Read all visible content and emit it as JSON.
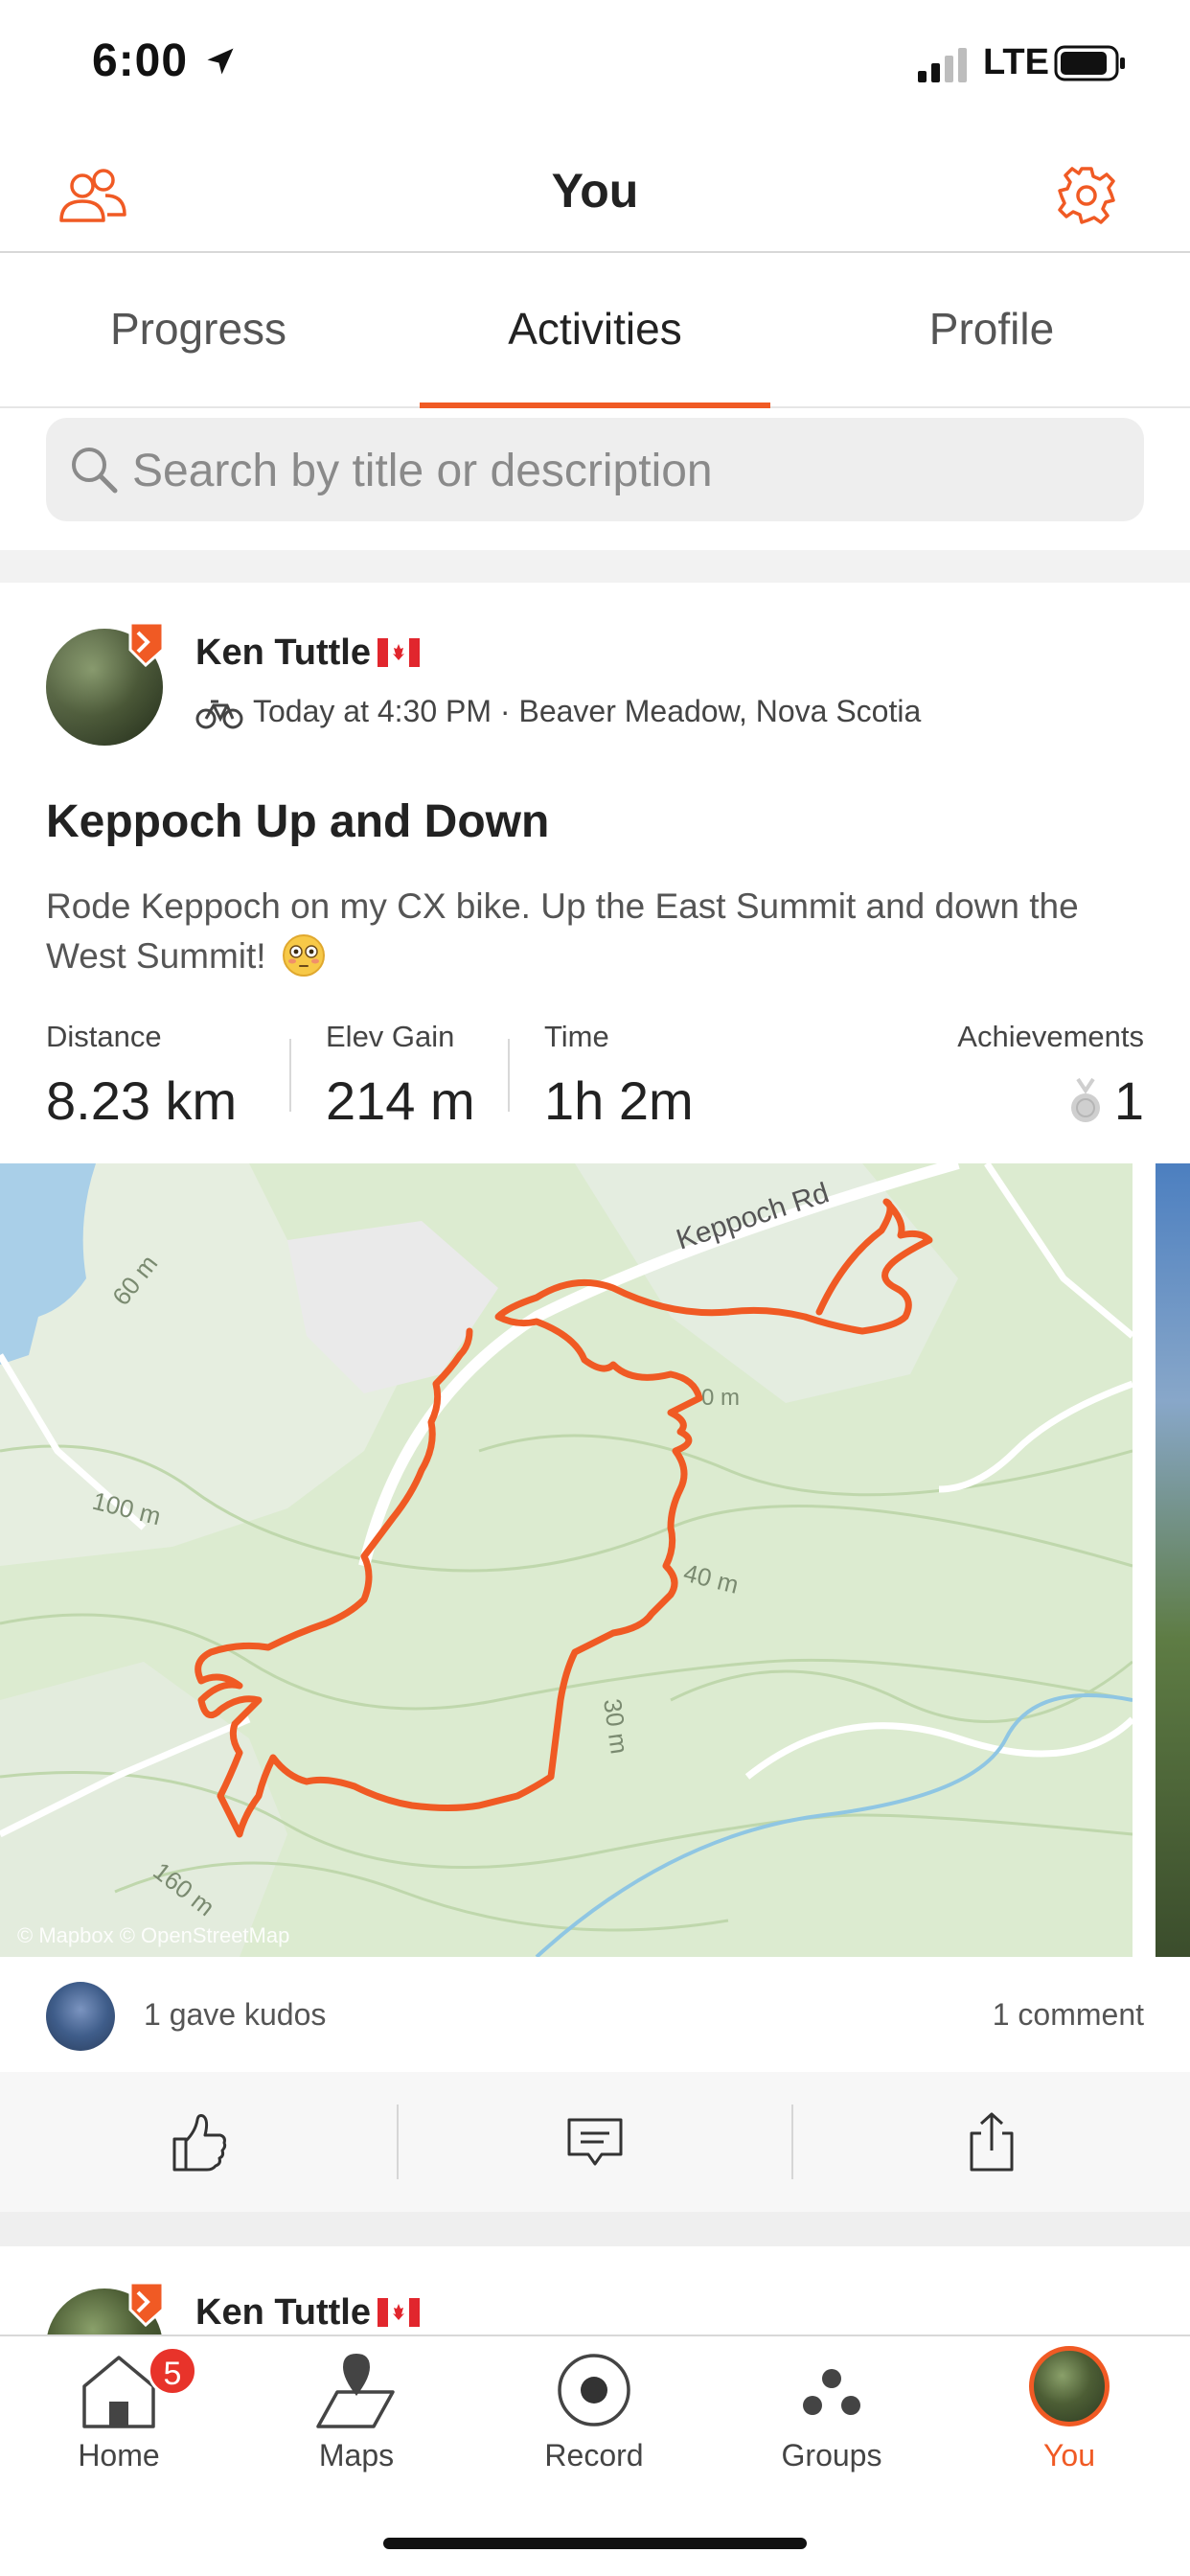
{
  "status_bar": {
    "time": "6:00",
    "network": "LTE"
  },
  "header": {
    "title": "You"
  },
  "tabs": [
    {
      "label": "Progress"
    },
    {
      "label": "Activities"
    },
    {
      "label": "Profile"
    }
  ],
  "search": {
    "placeholder": "Search by title or description"
  },
  "activity": {
    "athlete": "Ken Tuttle",
    "meta": "Today at 4:30 PM · Beaver Meadow, Nova Scotia",
    "title": "Keppoch Up and Down",
    "description": "Rode Keppoch on my CX bike. Up the East Summit and down the West Summit!",
    "stats": [
      {
        "label": "Distance",
        "value": "8.23 km"
      },
      {
        "label": "Elev Gain",
        "value": "214 m"
      },
      {
        "label": "Time",
        "value": "1h 2m"
      }
    ],
    "achievements": {
      "label": "Achievements",
      "value": "1"
    },
    "map": {
      "road_label": "Keppoch Rd",
      "contours": [
        "60 m",
        "100 m",
        "40 m",
        "30 m",
        "160 m"
      ],
      "partial_contour": "0 m",
      "attribution": "© Mapbox © OpenStreetMap"
    },
    "kudos": "1 gave kudos",
    "comments": "1 comment"
  },
  "next_activity": {
    "athlete": "Ken Tuttle"
  },
  "bottom_nav": {
    "items": [
      {
        "label": "Home",
        "badge": "5"
      },
      {
        "label": "Maps"
      },
      {
        "label": "Record"
      },
      {
        "label": "Groups"
      },
      {
        "label": "You"
      }
    ]
  },
  "colors": {
    "accent": "#f05a24",
    "route": "#f05a24",
    "map_bg": "#dcebd0"
  }
}
